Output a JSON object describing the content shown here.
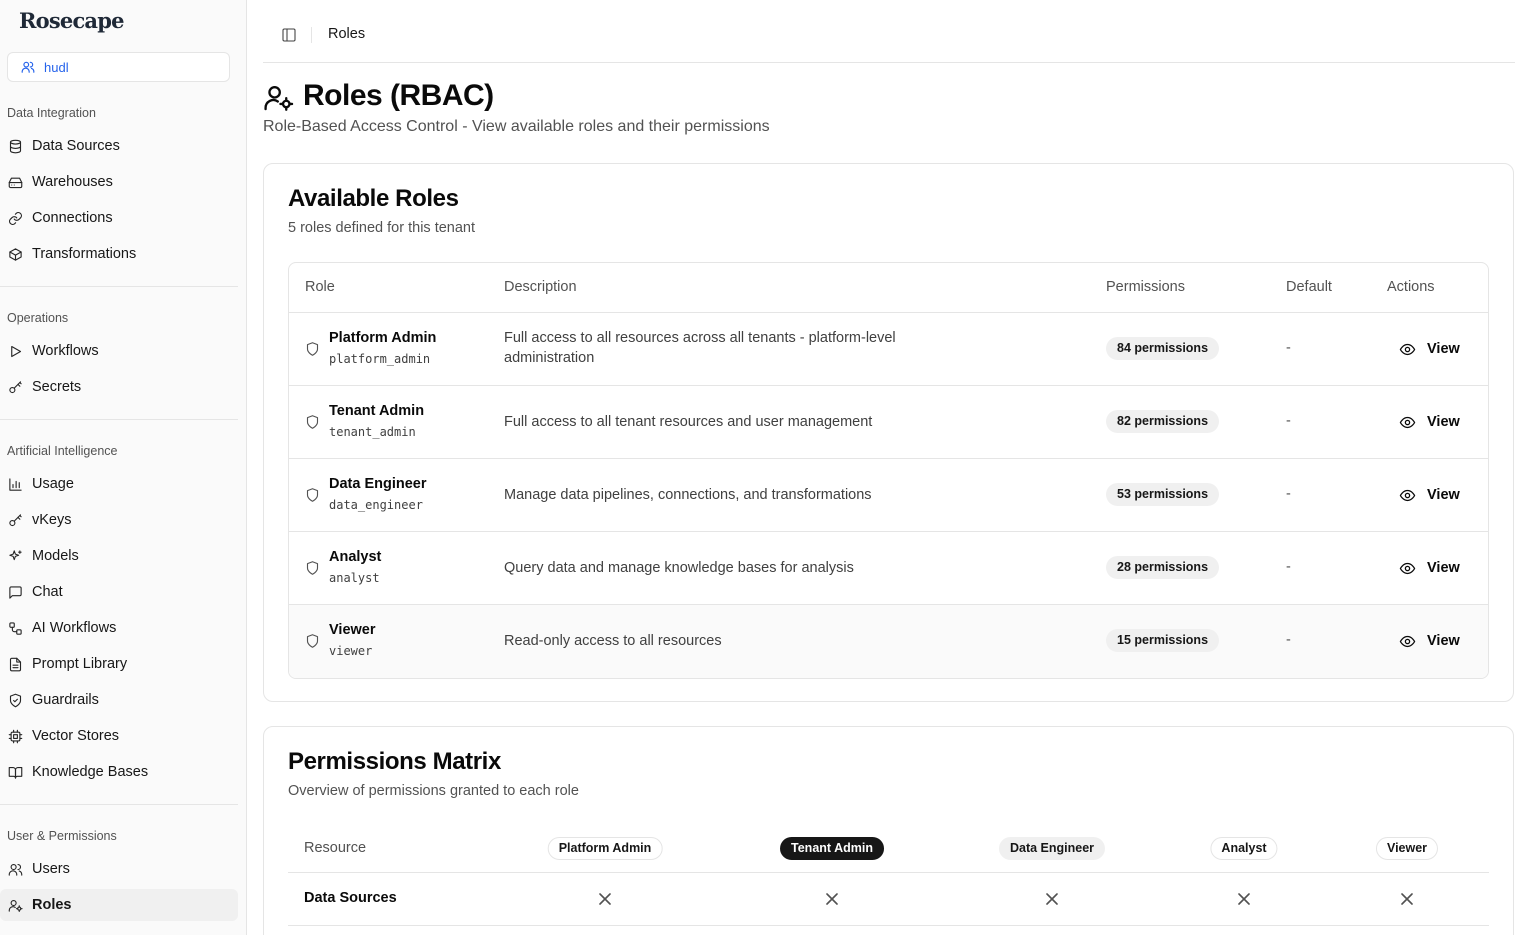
{
  "app": {
    "logo": "Rosecape"
  },
  "tenant": {
    "name": "hudl"
  },
  "sidebar": {
    "sections": [
      {
        "label": "Data Integration",
        "items": [
          "Data Sources",
          "Warehouses",
          "Connections",
          "Transformations"
        ]
      },
      {
        "label": "Operations",
        "items": [
          "Workflows",
          "Secrets"
        ]
      },
      {
        "label": "Artificial Intelligence",
        "items": [
          "Usage",
          "vKeys",
          "Models",
          "Chat",
          "AI Workflows",
          "Prompt Library",
          "Guardrails",
          "Vector Stores",
          "Knowledge Bases"
        ]
      },
      {
        "label": "User & Permissions",
        "items": [
          "Users",
          "Roles"
        ]
      }
    ],
    "active_item": "Roles"
  },
  "breadcrumb": {
    "current": "Roles"
  },
  "page": {
    "title": "Roles (RBAC)",
    "subtitle": "Role-Based Access Control - View available roles and their permissions"
  },
  "roles_card": {
    "title": "Available Roles",
    "subtitle": "5 roles defined for this tenant",
    "columns": [
      "Role",
      "Description",
      "Permissions",
      "Default",
      "Actions"
    ],
    "rows": [
      {
        "name": "Platform Admin",
        "code": "platform_admin",
        "description": "Full access to all resources across all tenants - platform-level administration",
        "permissions": "84 permissions",
        "default": "-",
        "action": "View"
      },
      {
        "name": "Tenant Admin",
        "code": "tenant_admin",
        "description": "Full access to all tenant resources and user management",
        "permissions": "82 permissions",
        "default": "-",
        "action": "View"
      },
      {
        "name": "Data Engineer",
        "code": "data_engineer",
        "description": "Manage data pipelines, connections, and transformations",
        "permissions": "53 permissions",
        "default": "-",
        "action": "View"
      },
      {
        "name": "Analyst",
        "code": "analyst",
        "description": "Query data and manage knowledge bases for analysis",
        "permissions": "28 permissions",
        "default": "-",
        "action": "View"
      },
      {
        "name": "Viewer",
        "code": "viewer",
        "description": "Read-only access to all resources",
        "permissions": "15 permissions",
        "default": "-",
        "action": "View"
      }
    ]
  },
  "matrix_card": {
    "title": "Permissions Matrix",
    "subtitle": "Overview of permissions granted to each role",
    "resource_header": "Resource",
    "roles": [
      "Platform Admin",
      "Tenant Admin",
      "Data Engineer",
      "Analyst",
      "Viewer"
    ],
    "rows": [
      {
        "resource": "Data Sources",
        "cells": [
          "x-icon",
          "x-icon",
          "x-icon",
          "x-icon",
          "x-icon"
        ]
      }
    ]
  },
  "colors": {
    "accent": "#2563eb",
    "active_bg": "#f0f0f0",
    "dark_pill": "#171717"
  }
}
